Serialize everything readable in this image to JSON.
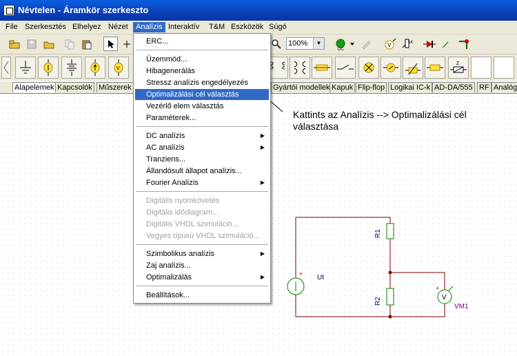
{
  "window": {
    "title": "Névtelen - Áramkör szerkeszto"
  },
  "menubar": {
    "items": [
      "File",
      "Szerkesztés",
      "Elhelyez",
      "Nézet",
      "Analízis",
      "Interaktív",
      "T&M",
      "Eszközök",
      "Súgó"
    ],
    "active": "Analízis"
  },
  "toolbar": {
    "zoom": "100%"
  },
  "component_tabs": [
    "Alapelemek",
    "Kapcsolók",
    "Műszerek",
    "Gyártói modellek",
    "Kapuk",
    "Flip-flop",
    "Logikai IC-k",
    "AD-DA/555",
    "RF",
    "Analóg"
  ],
  "dropdown": {
    "items": [
      {
        "label": "ERC...",
        "state": "normal"
      },
      {
        "label": "Üzemmód...",
        "state": "normal"
      },
      {
        "label": "Hibagenerálás",
        "state": "normal"
      },
      {
        "label": "Stressz analízis engedélyezés",
        "state": "normal"
      },
      {
        "label": "Optimalizálási cél választás",
        "state": "highlighted"
      },
      {
        "label": "Vezérlő elem választás",
        "state": "normal"
      },
      {
        "label": "Paraméterek...",
        "state": "normal"
      },
      {
        "label": "DC analízis",
        "state": "submenu"
      },
      {
        "label": "AC analízis",
        "state": "submenu"
      },
      {
        "label": "Tranziens...",
        "state": "normal"
      },
      {
        "label": "Állandósult állapot analízis...",
        "state": "normal"
      },
      {
        "label": "Fourier Analízis",
        "state": "submenu"
      },
      {
        "label": "Digitális nyomkövetés",
        "state": "disabled"
      },
      {
        "label": "Digitális idődiagram...",
        "state": "disabled"
      },
      {
        "label": "Digitális VHDL szimuláció...",
        "state": "disabled"
      },
      {
        "label": "Vegyes típusú VHDL szimuláció...",
        "state": "disabled"
      },
      {
        "label": "Szimbolikus analízis",
        "state": "submenu"
      },
      {
        "label": "Zaj analízis...",
        "state": "normal"
      },
      {
        "label": "Optimalizálás",
        "state": "submenu"
      },
      {
        "label": "Beállítások...",
        "state": "normal"
      }
    ]
  },
  "annotation": {
    "text": "Kattints az Analízis --> Optimalizálási cél választása"
  },
  "circuit": {
    "labels": {
      "r1": "R1",
      "r2": "R2",
      "source": "Ut",
      "voltmeter": "VM1",
      "voltmeter_symbol": "V",
      "plus": "+"
    }
  },
  "colors": {
    "accent": "#316ac5",
    "titlebar": "#0a3fb8",
    "wire": "#800000",
    "component": "#008000",
    "label": "#000080"
  }
}
